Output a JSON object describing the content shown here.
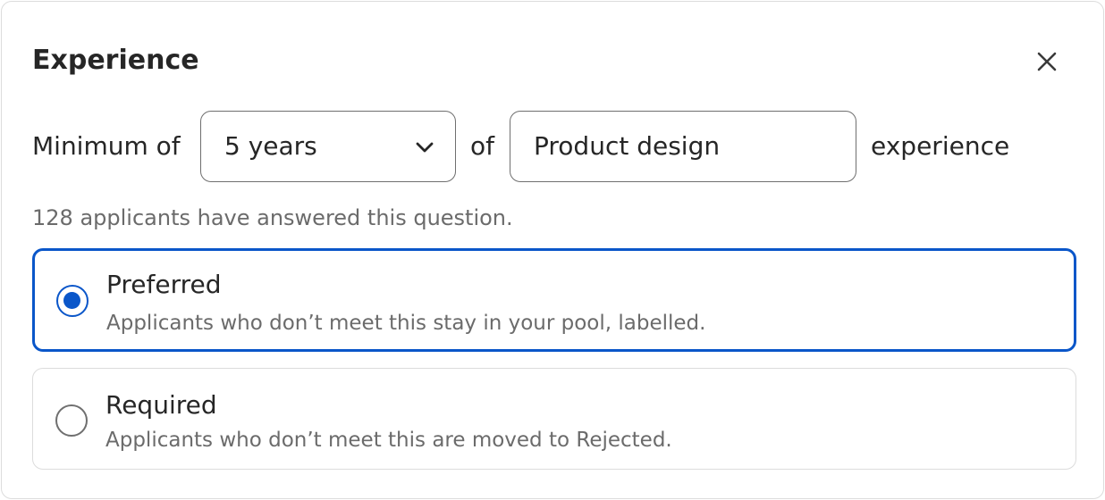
{
  "dialog": {
    "title": "Experience",
    "close_icon": "close-icon"
  },
  "criteria": {
    "prefix": "Minimum of",
    "years_select": {
      "value": "5 years",
      "icon": "chevron-down-icon"
    },
    "connector": "of",
    "field_input": {
      "value": "Product design"
    },
    "suffix": "experience"
  },
  "hint": "128 applicants have answered this question.",
  "options": [
    {
      "label": "Preferred",
      "description": "Applicants who don’t meet this stay in your pool, labelled.",
      "selected": true
    },
    {
      "label": "Required",
      "description": "Applicants who don’t meet this are moved to Rejected.",
      "selected": false
    }
  ],
  "colors": {
    "accent": "#0a56c9",
    "border": "#dcdcdc",
    "muted_text": "#6b6b6b"
  }
}
